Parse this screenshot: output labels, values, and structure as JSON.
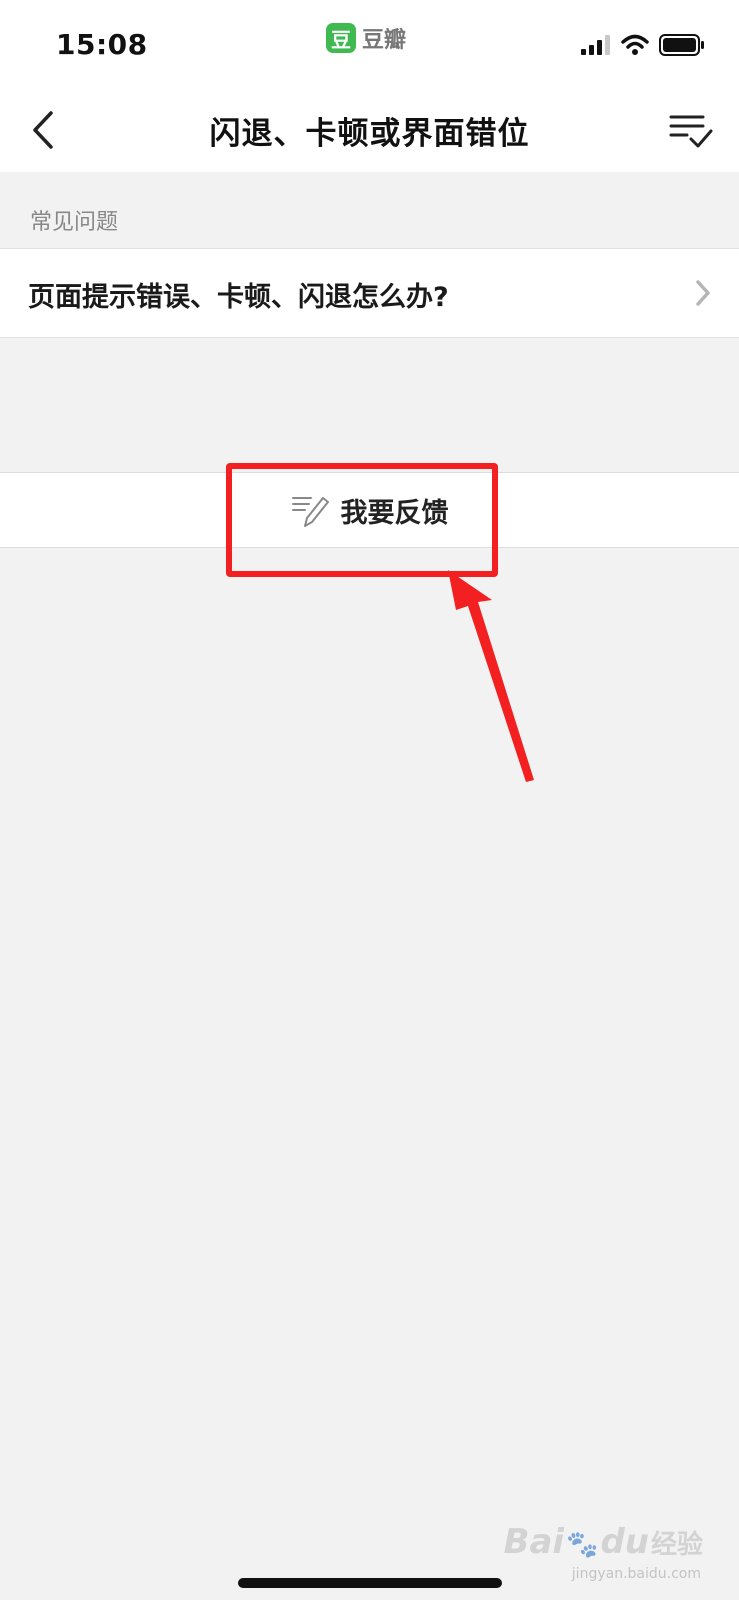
{
  "status_bar": {
    "time": "15:08",
    "app_logo_char": "豆",
    "app_name": "豆瓣"
  },
  "nav": {
    "title": "闪退、卡顿或界面错位"
  },
  "faq": {
    "section_label": "常见问题",
    "items": [
      {
        "label": "页面提示错误、卡顿、闪退怎么办?"
      }
    ]
  },
  "feedback": {
    "label": "我要反馈"
  },
  "watermark": {
    "brand": "Bai",
    "mid": "du",
    "text": "经验",
    "url": "jingyan.baidu.com"
  },
  "colors": {
    "highlight": "#f22020",
    "logo_green": "#3fb950",
    "background": "#f2f2f2"
  }
}
